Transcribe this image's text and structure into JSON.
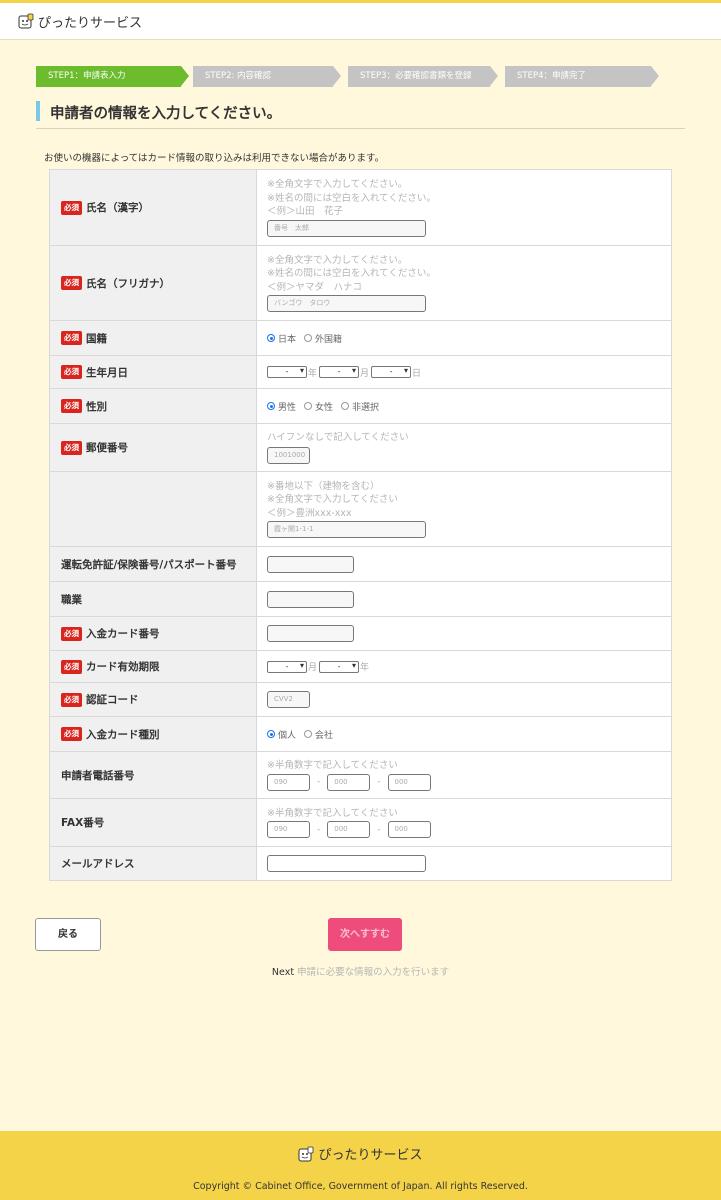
{
  "header": {
    "brand": "ぴったりサービス"
  },
  "steps": [
    {
      "label": "STEP1：申請表入力",
      "active": true
    },
    {
      "label": "STEP2: 内容確認",
      "active": false
    },
    {
      "label": "STEP3：必要確認書類を登録",
      "active": false
    },
    {
      "label": "STEP4：申請完了",
      "active": false
    }
  ],
  "page_title": "申請者の情報を入力してください。",
  "notice": "お使いの機器によってはカード情報の取り込みは利用できない場合があります。",
  "required_badge": "必須",
  "fields": {
    "name_kanji": {
      "label": "氏名（漢字）",
      "hints": [
        "※全角文字で入力してください。",
        "※姓名の間には空白を入れてください。",
        "＜例＞山田　花子"
      ],
      "placeholder": "番号　太郎"
    },
    "name_kana": {
      "label": "氏名（フリガナ）",
      "hints": [
        "※全角文字で入力してください。",
        "※姓名の間には空白を入れてください。",
        "＜例＞ヤマダ　ハナコ"
      ],
      "placeholder": "バンゴウ　タロウ"
    },
    "nationality": {
      "label": "国籍",
      "options": [
        "日本",
        "外国籍"
      ],
      "selected": "日本"
    },
    "birthdate": {
      "label": "生年月日",
      "select_value": "-",
      "units": [
        "年",
        "月",
        "日"
      ]
    },
    "gender": {
      "label": "性別",
      "options": [
        "男性",
        "女性",
        "非選択"
      ],
      "selected": "男性"
    },
    "postal": {
      "label": "郵便番号",
      "hint": "ハイフンなしで記入してください",
      "placeholder": "1001000"
    },
    "address": {
      "label": "",
      "hints": [
        "※番地以下（建物を含む）",
        "※全角文字で入力してください",
        "＜例＞豊洲xxx-xxx"
      ],
      "placeholder": "霞ヶ関1-1-1"
    },
    "license": {
      "label": "運転免許証/保険番号/パスポート番号"
    },
    "occupation": {
      "label": "職業"
    },
    "card_number": {
      "label": "入金カード番号"
    },
    "card_expiry": {
      "label": "カード有効期限",
      "select_value": "-",
      "units": [
        "月",
        "年"
      ]
    },
    "auth_code": {
      "label": "認証コード",
      "placeholder": "CVV2"
    },
    "card_type": {
      "label": "入金カード種別",
      "options": [
        "個人",
        "会社"
      ],
      "selected": "個人"
    },
    "phone": {
      "label": "申請者電話番号",
      "hint": "※半角数字で記入してください",
      "placeholders": [
        "090",
        "000",
        "000"
      ],
      "separator": "-"
    },
    "fax": {
      "label": "FAX番号",
      "hint": "※半角数字で記入してください",
      "placeholders": [
        "090",
        "000",
        "000"
      ],
      "separator": "-"
    },
    "email": {
      "label": "メールアドレス"
    }
  },
  "buttons": {
    "back": "戻る",
    "next": "次へすすむ"
  },
  "next_note": {
    "key": "Next",
    "desc": "申請に必要な情報の入力を行います"
  },
  "footer": {
    "brand": "ぴったりサービス",
    "copyright": "Copyright © Cabinet Office, Government of Japan. All rights Reserved."
  },
  "colors": {
    "accent_green": "#6cbc2e",
    "required_red": "#d9251d",
    "next_pink": "#ee4d7c",
    "footer_yellow": "#f5d348"
  }
}
